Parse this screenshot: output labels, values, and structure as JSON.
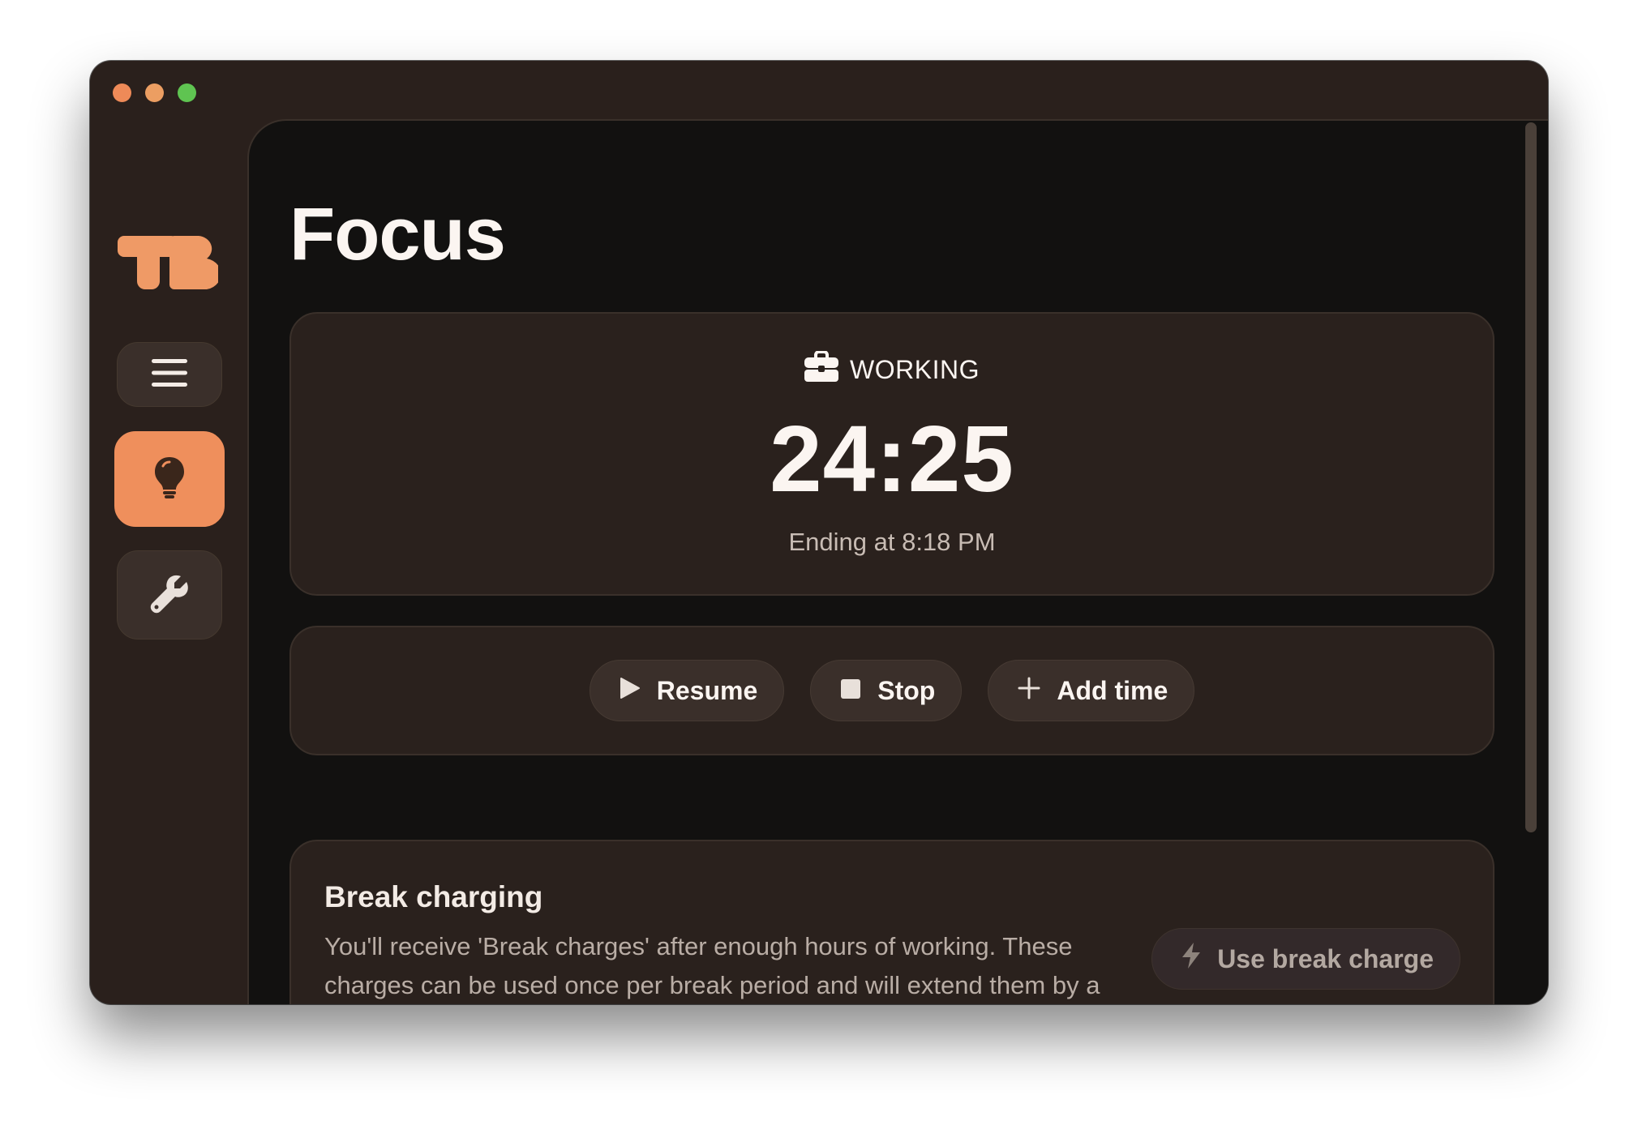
{
  "window": {
    "colors": {
      "accent": "#ef8f5c",
      "background": "#2a201c",
      "content_background": "#121110",
      "card": "#2a211d"
    },
    "traffic_lights": [
      "close",
      "minimize",
      "maximize"
    ]
  },
  "sidebar": {
    "logo_text": "TB",
    "items": [
      {
        "name": "menu",
        "icon": "hamburger-menu-icon",
        "active": false
      },
      {
        "name": "focus",
        "icon": "lightbulb-icon",
        "active": true
      },
      {
        "name": "tools",
        "icon": "wrench-icon",
        "active": false
      }
    ]
  },
  "main": {
    "title": "Focus",
    "timer": {
      "status_icon": "briefcase-icon",
      "status": "WORKING",
      "time": "24:25",
      "ending": "Ending at 8:18 PM"
    },
    "controls": {
      "resume_label": "Resume",
      "stop_label": "Stop",
      "add_time_label": "Add time"
    },
    "break_charging": {
      "title": "Break charging",
      "description": "You'll receive 'Break charges' after enough hours of working. These charges can be used once per break period and will extend them by a few minutes as a reward for working hard!",
      "button_label": "Use break charge",
      "button_icon": "lightning-bolt-icon"
    }
  }
}
